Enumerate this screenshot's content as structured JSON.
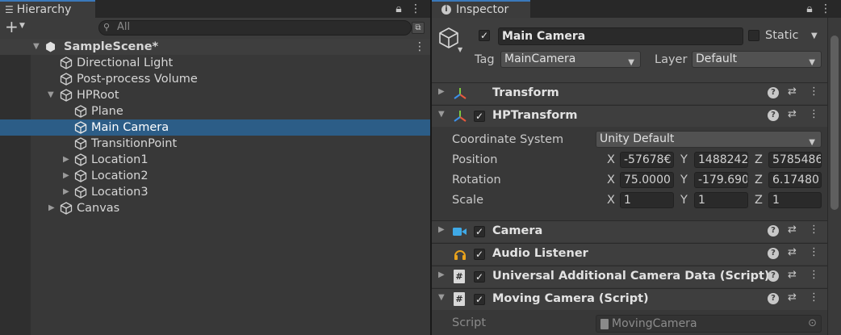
{
  "hierarchy": {
    "tab_label": "Hierarchy",
    "add_label": "+",
    "search_placeholder": "All",
    "scene_name": "SampleScene*",
    "items": [
      {
        "label": "Directional Light"
      },
      {
        "label": "Post-process Volume"
      },
      {
        "label": "HPRoot"
      },
      {
        "label": "Plane"
      },
      {
        "label": "Main Camera",
        "selected": true
      },
      {
        "label": "TransitionPoint"
      },
      {
        "label": "Location1"
      },
      {
        "label": "Location2"
      },
      {
        "label": "Location3"
      },
      {
        "label": "Canvas"
      }
    ]
  },
  "inspector": {
    "tab_label": "Inspector",
    "object_name": "Main Camera",
    "static_label": "Static",
    "tag_label": "Tag",
    "tag_value": "MainCamera",
    "layer_label": "Layer",
    "layer_value": "Default",
    "components": {
      "transform": "Transform",
      "hptransform": "HPTransform",
      "camera": "Camera",
      "audio_listener": "Audio Listener",
      "universal": "Universal Additional Camera Data (Script)",
      "moving": "Moving Camera (Script)"
    },
    "hp": {
      "coord_label": "Coordinate System",
      "coord_value": "Unity Default",
      "position_label": "Position",
      "rotation_label": "Rotation",
      "scale_label": "Scale",
      "x": "X",
      "y": "Y",
      "z": "Z",
      "position": [
        "-57678€",
        "1488242",
        "5785486"
      ],
      "rotation": [
        "75.0000",
        "-179.690",
        "6.17480"
      ],
      "scale": [
        "1",
        "1",
        "1"
      ]
    },
    "script_label": "Script",
    "script_value": "MovingCamera"
  },
  "colors": {
    "selection": "#2c5d87",
    "panel": "#383838",
    "header": "#3e3e3e"
  }
}
